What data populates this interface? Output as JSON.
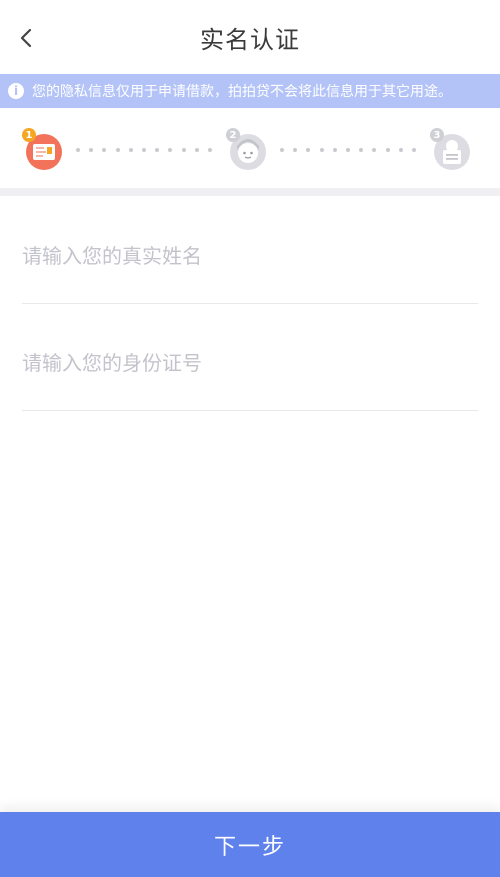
{
  "header": {
    "title": "实名认证",
    "back_icon": "chevron-left-icon"
  },
  "notice": {
    "text": "您的隐私信息仅用于申请借款，拍拍贷不会将此信息用于其它用途。",
    "icon": "info-icon"
  },
  "steps": [
    {
      "number": "1",
      "icon": "id-card-icon",
      "active": true,
      "color": "#f2735a"
    },
    {
      "number": "2",
      "icon": "face-icon",
      "active": false,
      "color": "#d6d6dc"
    },
    {
      "number": "3",
      "icon": "document-icon",
      "active": false,
      "color": "#d6d6dc"
    }
  ],
  "form": {
    "name_placeholder": "请输入您的真实姓名",
    "name_value": "",
    "id_placeholder": "请输入您的身份证号",
    "id_value": ""
  },
  "footer": {
    "next_label": "下一步"
  },
  "colors": {
    "accent": "#5f81ec",
    "notice_bg": "#b3c3f7",
    "active_step": "#f2735a"
  }
}
